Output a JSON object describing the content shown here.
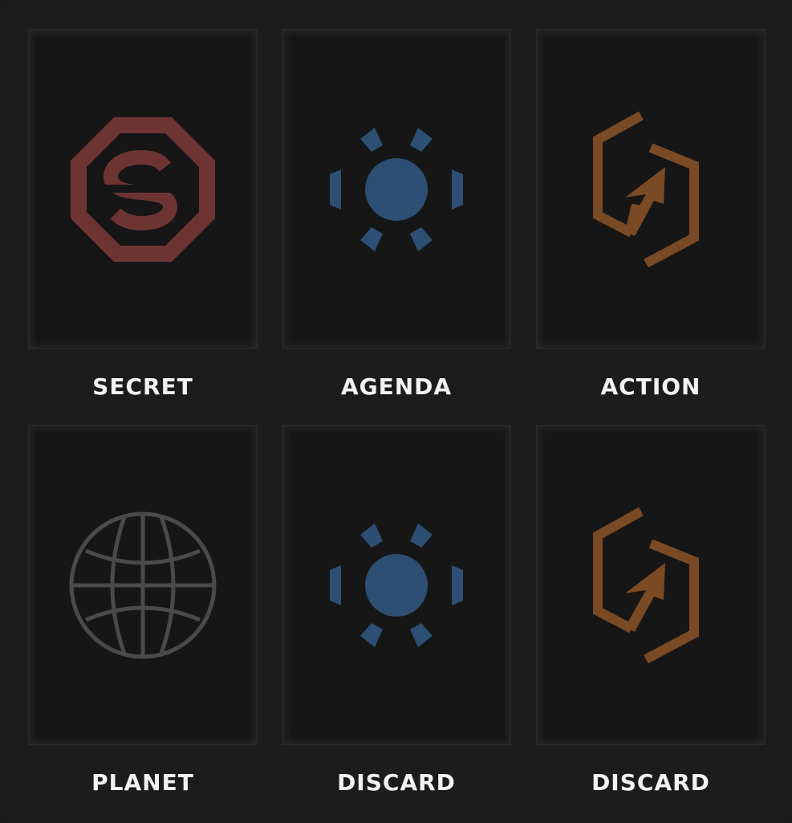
{
  "decks": [
    {
      "label": "SECRET",
      "icon": "secret-objective-icon",
      "color": "#6e3434"
    },
    {
      "label": "AGENDA",
      "icon": "agenda-icon",
      "color": "#2c4f73"
    },
    {
      "label": "ACTION",
      "icon": "action-icon",
      "color": "#7a4a24"
    },
    {
      "label": "PLANET",
      "icon": "planet-globe-icon",
      "color": "#4a4a4a"
    },
    {
      "label": "DISCARD",
      "icon": "agenda-icon",
      "color": "#2c4f73"
    },
    {
      "label": "DISCARD",
      "icon": "action-icon",
      "color": "#7a4a24"
    }
  ]
}
